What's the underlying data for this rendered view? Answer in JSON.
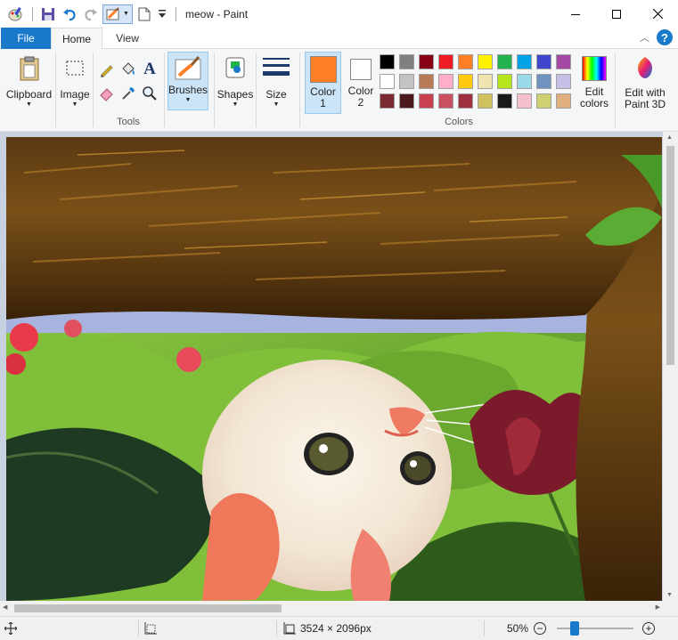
{
  "window": {
    "title": "meow - Paint"
  },
  "tabs": {
    "file": "File",
    "home": "Home",
    "view": "View"
  },
  "ribbon": {
    "clipboard": "Clipboard",
    "image": "Image",
    "tools_group": "Tools",
    "brushes": "Brushes",
    "shapes": "Shapes",
    "size": "Size",
    "color1_line1": "Color",
    "color1_line2": "1",
    "color2_line1": "Color",
    "color2_line2": "2",
    "edit_colors_line1": "Edit",
    "edit_colors_line2": "colors",
    "edit_paint3d_line1": "Edit with",
    "edit_paint3d_line2": "Paint 3D",
    "colors_group": "Colors",
    "color1_value": "#ff7f27",
    "color2_value": "#ffffff",
    "palette": [
      "#000000",
      "#7f7f7f",
      "#880015",
      "#ed1c24",
      "#ff7f27",
      "#fff200",
      "#22b14c",
      "#00a2e8",
      "#3f48cc",
      "#a349a4",
      "#ffffff",
      "#c3c3c3",
      "#b97a57",
      "#ffaec9",
      "#ffc90e",
      "#efe4b0",
      "#b5e61d",
      "#99d9ea",
      "#7092be",
      "#c8bfe7",
      "#7a2a30",
      "#4a1a1f",
      "#c94050",
      "#c85060",
      "#a03040",
      "#cfc060",
      "#1a1a1a",
      "#f3c0cc",
      "#cfd070",
      "#e0b080"
    ]
  },
  "status": {
    "dimensions": "3524 × 2096px",
    "zoom": "50%"
  }
}
